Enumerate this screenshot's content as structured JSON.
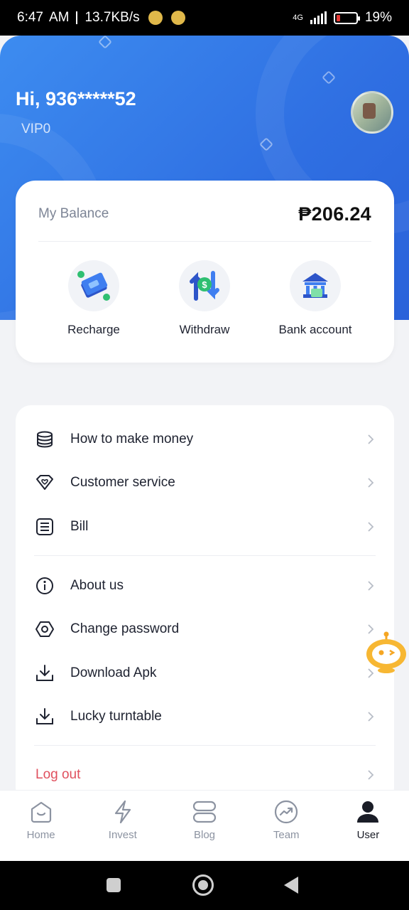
{
  "status_bar": {
    "time": "6:47",
    "ampm": "AM",
    "network_speed": "13.7KB/s",
    "network_type": "4G",
    "battery_percent": "19%",
    "battery_level": 0.19
  },
  "header": {
    "greeting": "Hi, 936*****52",
    "vip_level": "VIP0"
  },
  "balance": {
    "label": "My Balance",
    "amount": "₱206.24"
  },
  "actions": [
    {
      "label": "Recharge",
      "icon": "recharge-icon"
    },
    {
      "label": "Withdraw",
      "icon": "withdraw-icon"
    },
    {
      "label": "Bank account",
      "icon": "bank-icon"
    }
  ],
  "menu": {
    "group1": [
      {
        "label": "How to make money",
        "icon": "database-icon"
      },
      {
        "label": "Customer service",
        "icon": "heart-diamond-icon"
      },
      {
        "label": "Bill",
        "icon": "bill-icon"
      }
    ],
    "group2": [
      {
        "label": "About us",
        "icon": "info-icon"
      },
      {
        "label": "Change password",
        "icon": "hexagon-icon"
      },
      {
        "label": "Download Apk",
        "icon": "download-icon"
      },
      {
        "label": "Lucky turntable",
        "icon": "download-icon"
      }
    ],
    "logout": "Log out"
  },
  "tabs": [
    {
      "label": "Home",
      "icon": "home-icon",
      "active": false
    },
    {
      "label": "Invest",
      "icon": "lightning-icon",
      "active": false
    },
    {
      "label": "Blog",
      "icon": "blog-icon",
      "active": false
    },
    {
      "label": "Team",
      "icon": "trend-icon",
      "active": false
    },
    {
      "label": "User",
      "icon": "user-icon",
      "active": true
    }
  ],
  "colors": {
    "header_blue": "#2f6fe2",
    "logout_red": "#e0505e",
    "battery_red": "#e53935",
    "active_tab": "#1a1d27",
    "inactive_tab": "#8c93a1"
  }
}
